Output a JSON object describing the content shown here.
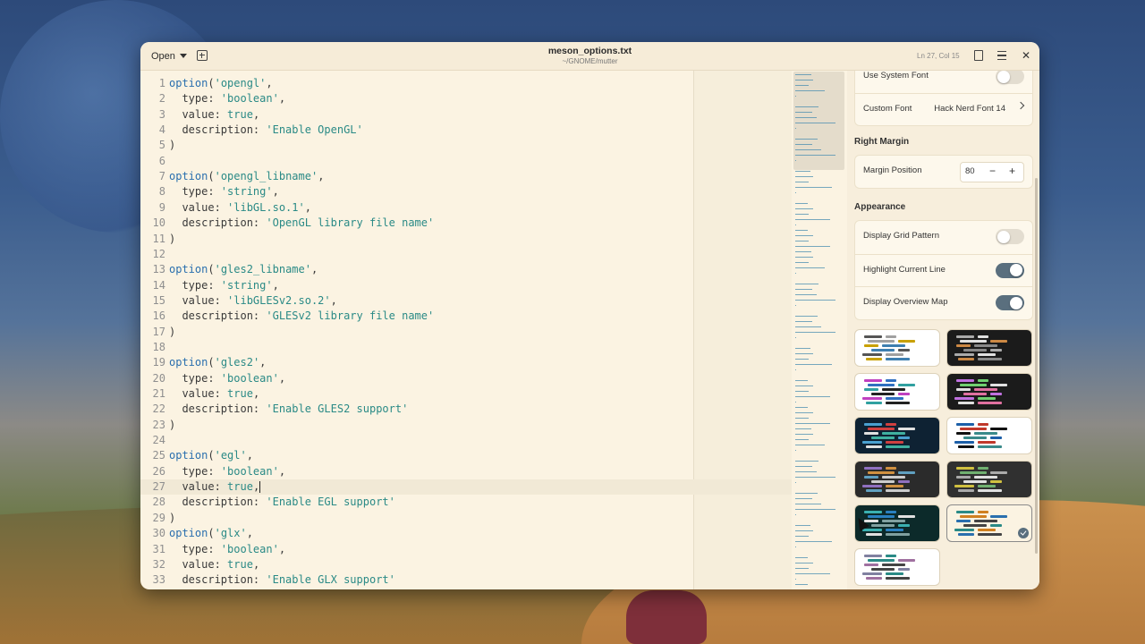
{
  "header": {
    "open_label": "Open",
    "title": "meson_options.txt",
    "subtitle": "~/GNOME/mutter",
    "cursor_position": "Ln 27, Col 15"
  },
  "editor": {
    "current_line": 27,
    "lines": [
      {
        "n": "1",
        "parts": [
          {
            "t": "option",
            "c": "fn"
          },
          {
            "t": "(",
            "c": ""
          },
          {
            "t": "'opengl'",
            "c": "str"
          },
          {
            "t": ",",
            "c": ""
          }
        ]
      },
      {
        "n": "2",
        "parts": [
          {
            "t": "  type: ",
            "c": ""
          },
          {
            "t": "'boolean'",
            "c": "str"
          },
          {
            "t": ",",
            "c": ""
          }
        ]
      },
      {
        "n": "3",
        "parts": [
          {
            "t": "  value: ",
            "c": ""
          },
          {
            "t": "true",
            "c": "str"
          },
          {
            "t": ",",
            "c": ""
          }
        ]
      },
      {
        "n": "4",
        "parts": [
          {
            "t": "  description: ",
            "c": ""
          },
          {
            "t": "'Enable OpenGL'",
            "c": "str"
          }
        ]
      },
      {
        "n": "5",
        "parts": [
          {
            "t": ")",
            "c": ""
          }
        ]
      },
      {
        "n": "6",
        "parts": []
      },
      {
        "n": "7",
        "parts": [
          {
            "t": "option",
            "c": "fn"
          },
          {
            "t": "(",
            "c": ""
          },
          {
            "t": "'opengl_libname'",
            "c": "str"
          },
          {
            "t": ",",
            "c": ""
          }
        ]
      },
      {
        "n": "8",
        "parts": [
          {
            "t": "  type: ",
            "c": ""
          },
          {
            "t": "'string'",
            "c": "str"
          },
          {
            "t": ",",
            "c": ""
          }
        ]
      },
      {
        "n": "9",
        "parts": [
          {
            "t": "  value: ",
            "c": ""
          },
          {
            "t": "'libGL.so.1'",
            "c": "str"
          },
          {
            "t": ",",
            "c": ""
          }
        ]
      },
      {
        "n": "10",
        "parts": [
          {
            "t": "  description: ",
            "c": ""
          },
          {
            "t": "'OpenGL library file name'",
            "c": "str"
          }
        ]
      },
      {
        "n": "11",
        "parts": [
          {
            "t": ")",
            "c": ""
          }
        ]
      },
      {
        "n": "12",
        "parts": []
      },
      {
        "n": "13",
        "parts": [
          {
            "t": "option",
            "c": "fn"
          },
          {
            "t": "(",
            "c": ""
          },
          {
            "t": "'gles2_libname'",
            "c": "str"
          },
          {
            "t": ",",
            "c": ""
          }
        ]
      },
      {
        "n": "14",
        "parts": [
          {
            "t": "  type: ",
            "c": ""
          },
          {
            "t": "'string'",
            "c": "str"
          },
          {
            "t": ",",
            "c": ""
          }
        ]
      },
      {
        "n": "15",
        "parts": [
          {
            "t": "  value: ",
            "c": ""
          },
          {
            "t": "'libGLESv2.so.2'",
            "c": "str"
          },
          {
            "t": ",",
            "c": ""
          }
        ]
      },
      {
        "n": "16",
        "parts": [
          {
            "t": "  description: ",
            "c": ""
          },
          {
            "t": "'GLESv2 library file name'",
            "c": "str"
          }
        ]
      },
      {
        "n": "17",
        "parts": [
          {
            "t": ")",
            "c": ""
          }
        ]
      },
      {
        "n": "18",
        "parts": []
      },
      {
        "n": "19",
        "parts": [
          {
            "t": "option",
            "c": "fn"
          },
          {
            "t": "(",
            "c": ""
          },
          {
            "t": "'gles2'",
            "c": "str"
          },
          {
            "t": ",",
            "c": ""
          }
        ]
      },
      {
        "n": "20",
        "parts": [
          {
            "t": "  type: ",
            "c": ""
          },
          {
            "t": "'boolean'",
            "c": "str"
          },
          {
            "t": ",",
            "c": ""
          }
        ]
      },
      {
        "n": "21",
        "parts": [
          {
            "t": "  value: ",
            "c": ""
          },
          {
            "t": "true",
            "c": "str"
          },
          {
            "t": ",",
            "c": ""
          }
        ]
      },
      {
        "n": "22",
        "parts": [
          {
            "t": "  description: ",
            "c": ""
          },
          {
            "t": "'Enable GLES2 support'",
            "c": "str"
          }
        ]
      },
      {
        "n": "23",
        "parts": [
          {
            "t": ")",
            "c": ""
          }
        ]
      },
      {
        "n": "24",
        "parts": []
      },
      {
        "n": "25",
        "parts": [
          {
            "t": "option",
            "c": "fn"
          },
          {
            "t": "(",
            "c": ""
          },
          {
            "t": "'egl'",
            "c": "str"
          },
          {
            "t": ",",
            "c": ""
          }
        ]
      },
      {
        "n": "26",
        "parts": [
          {
            "t": "  type: ",
            "c": ""
          },
          {
            "t": "'boolean'",
            "c": "str"
          },
          {
            "t": ",",
            "c": ""
          }
        ]
      },
      {
        "n": "27",
        "parts": [
          {
            "t": "  value: ",
            "c": ""
          },
          {
            "t": "true",
            "c": "str"
          },
          {
            "t": ",",
            "c": ""
          }
        ]
      },
      {
        "n": "28",
        "parts": [
          {
            "t": "  description: ",
            "c": ""
          },
          {
            "t": "'Enable EGL support'",
            "c": "str"
          }
        ]
      },
      {
        "n": "29",
        "parts": [
          {
            "t": ")",
            "c": ""
          }
        ]
      },
      {
        "n": "30",
        "parts": [
          {
            "t": "option",
            "c": "fn"
          },
          {
            "t": "(",
            "c": ""
          },
          {
            "t": "'glx'",
            "c": "str"
          },
          {
            "t": ",",
            "c": ""
          }
        ]
      },
      {
        "n": "31",
        "parts": [
          {
            "t": "  type: ",
            "c": ""
          },
          {
            "t": "'boolean'",
            "c": "str"
          },
          {
            "t": ",",
            "c": ""
          }
        ]
      },
      {
        "n": "32",
        "parts": [
          {
            "t": "  value: ",
            "c": ""
          },
          {
            "t": "true",
            "c": "str"
          },
          {
            "t": ",",
            "c": ""
          }
        ]
      },
      {
        "n": "33",
        "parts": [
          {
            "t": "  description: ",
            "c": ""
          },
          {
            "t": "'Enable GLX support'",
            "c": "str"
          }
        ]
      }
    ]
  },
  "sidebar": {
    "use_system_font_label": "Use System Font",
    "use_system_font": false,
    "custom_font_label": "Custom Font",
    "custom_font_value": "Hack Nerd Font 14",
    "right_margin_heading": "Right Margin",
    "margin_position_label": "Margin Position",
    "margin_position_value": "80",
    "appearance_heading": "Appearance",
    "toggles": [
      {
        "label": "Display Grid Pattern",
        "on": false
      },
      {
        "label": "Highlight Current Line",
        "on": true
      },
      {
        "label": "Display Overview Map",
        "on": true
      }
    ]
  },
  "schemes": [
    {
      "bg": "#ffffff",
      "colors": [
        "#555555",
        "#a0a0a0",
        "#c8a000",
        "#3e7fb0"
      ]
    },
    {
      "bg": "#1b1b1b",
      "colors": [
        "#aaaaaa",
        "#e0e0e0",
        "#cc8844",
        "#888888"
      ]
    },
    {
      "bg": "#ffffff",
      "colors": [
        "#c040c0",
        "#3070c0",
        "#30a0a0",
        "#222222"
      ]
    },
    {
      "bg": "#1b1b1b",
      "colors": [
        "#c070e0",
        "#70d070",
        "#e0e0e0",
        "#e070a0"
      ]
    },
    {
      "bg": "#0e2233",
      "colors": [
        "#4aa0d0",
        "#d04040",
        "#e0e0e0",
        "#40b0a0"
      ]
    },
    {
      "bg": "#ffffff",
      "colors": [
        "#1d5fa8",
        "#c0392b",
        "#111111",
        "#3a8a8a"
      ]
    },
    {
      "bg": "#2b2b2b",
      "colors": [
        "#9070c0",
        "#d09040",
        "#60a0c0",
        "#cccccc"
      ]
    },
    {
      "bg": "#303030",
      "colors": [
        "#d0c040",
        "#70b070",
        "#aaaaaa",
        "#e0e0e0"
      ]
    },
    {
      "bg": "#0c2a2a",
      "colors": [
        "#3ab0b0",
        "#2a80c0",
        "#e0e0e0",
        "#80a0a0"
      ]
    },
    {
      "bg": "#fbf3e2",
      "colors": [
        "#2a8a86",
        "#d08020",
        "#2a6fae",
        "#444444"
      ],
      "selected": true
    },
    {
      "bg": "#ffffff",
      "colors": [
        "#8080a0",
        "#2a8a86",
        "#a070a0",
        "#444444"
      ]
    }
  ]
}
